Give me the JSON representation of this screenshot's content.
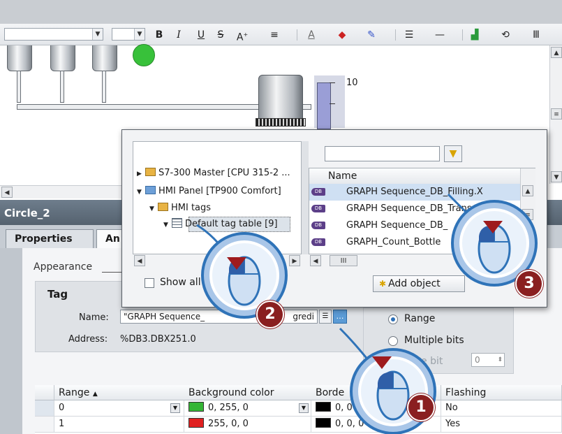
{
  "toolbar": {
    "font_size_value": "",
    "bold": "B",
    "italic": "I",
    "underline": "U",
    "strike": "S",
    "grow_font": "A"
  },
  "canvas": {
    "gauge_value": "10"
  },
  "inspector": {
    "title": "Circle_2",
    "tabs": [
      {
        "label": "Properties",
        "active": false
      },
      {
        "label": "An",
        "active": true
      }
    ],
    "section_label": "Appearance",
    "tag_group_title": "Tag",
    "name_label": "Name:",
    "name_value": "\"GRAPH Sequence_",
    "name_value_tail": "gredi",
    "address_label": "Address:",
    "address_value": "%DB3.DBX251.0",
    "type_options": [
      {
        "label": "Range",
        "selected": true
      },
      {
        "label": "Multiple bits",
        "selected": false
      },
      {
        "label": "e bit",
        "selected": false
      }
    ],
    "bit_value": "0",
    "grid": {
      "headers": [
        "Range",
        "Background color",
        "Borde",
        "Flashing"
      ],
      "rows": [
        {
          "range": "0",
          "bg": "0, 255, 0",
          "bg_color": "#35b535",
          "border": "0, 0",
          "border_color": "#000000",
          "flashing": "No"
        },
        {
          "range": "1",
          "bg": "255, 0, 0",
          "bg_color": "#e02020",
          "border": "0, 0, 0",
          "border_color": "#000000",
          "flashing": "Yes"
        }
      ]
    }
  },
  "popup": {
    "tree": [
      {
        "label": "S7-300 Master [CPU 315-2 ...",
        "icon": "folder-icon"
      },
      {
        "label": "HMI Panel [TP900 Comfort]",
        "icon": "hmi-panel-icon"
      },
      {
        "label": "HMI tags",
        "icon": "folder-icon"
      },
      {
        "label": "Default tag table [9]",
        "icon": "tag-table-icon"
      }
    ],
    "list_header": "Name",
    "list_items": [
      {
        "label": "GRAPH Sequence_DB_Filling.X",
        "selected": true
      },
      {
        "label": "GRAPH Sequence_DB_Transport Fillin",
        "selected": false
      },
      {
        "label": "GRAPH Sequence_DB_",
        "selected": false
      },
      {
        "label": "GRAPH_Count_Bottle",
        "selected": false
      }
    ],
    "show_all_label": "Show all",
    "add_object_label": "Add object",
    "scroll_thumb": "III"
  },
  "callouts": [
    "1",
    "2",
    "3"
  ],
  "colors": {
    "badge": "#8a1f20",
    "callout_blue": "#2f73b8",
    "selection": "#cfe0f3"
  }
}
